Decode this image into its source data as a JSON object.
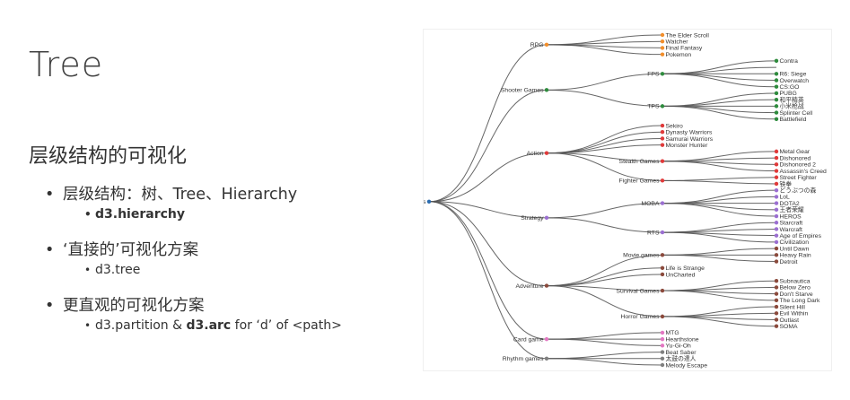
{
  "slide": {
    "title": "Tree",
    "subtitle": "层级结构的可视化",
    "bullets": [
      {
        "text": "层级结构：树、Tree、Hierarchy",
        "sub_bold": "d3.hierarchy"
      },
      {
        "text": "‘直接的’可视化方案",
        "sub": "d3.tree"
      },
      {
        "text": "更直观的可视化方案",
        "sub_parts": [
          "d3.partition & ",
          "d3.arc",
          " for ‘d’ of <path>"
        ]
      }
    ]
  },
  "tree": {
    "name": "Games",
    "color": "#2b6cb0",
    "children": [
      {
        "name": "RPG",
        "color": "#f28e2b",
        "children": [
          {
            "name": "The Elder Scroll"
          },
          {
            "name": "Watcher"
          },
          {
            "name": "Final Fantasy"
          },
          {
            "name": "Pokemon"
          }
        ]
      },
      {
        "name": "Shooter Games",
        "color": "#2e8b3d",
        "children": [
          {
            "name": "FPS",
            "children": [
              {
                "name": "Contra"
              },
              {
                "name": "~",
                "hidden": true
              },
              {
                "name": "R6: Siege"
              },
              {
                "name": "Overwatch"
              },
              {
                "name": "CS:GO"
              }
            ]
          },
          {
            "name": "TPS",
            "children": [
              {
                "name": "PUBG"
              },
              {
                "name": "和平精英"
              },
              {
                "name": "小米枪战"
              },
              {
                "name": "Splinter Cell"
              },
              {
                "name": "Battlefield"
              }
            ]
          }
        ]
      },
      {
        "name": "Action",
        "color": "#e03a3a",
        "children": [
          {
            "name": "Sekiro"
          },
          {
            "name": "Dynasty Warriors"
          },
          {
            "name": "Samurai Warriors"
          },
          {
            "name": "Monster Hunter"
          },
          {
            "name": "Stealth Games",
            "children": [
              {
                "name": "Metal Gear"
              },
              {
                "name": "Dishonored"
              },
              {
                "name": "Dishonored 2"
              },
              {
                "name": "Assassin's Creed"
              }
            ]
          },
          {
            "name": "Fighter Games",
            "children": [
              {
                "name": "Street Fighter"
              },
              {
                "name": "铁拳"
              }
            ]
          }
        ]
      },
      {
        "name": "Strategy",
        "color": "#9b6fd1",
        "children": [
          {
            "name": "MOBA",
            "children": [
              {
                "name": "どうぶつの森"
              },
              {
                "name": "LoL"
              },
              {
                "name": "DOTA2"
              },
              {
                "name": "王者荣耀"
              },
              {
                "name": "HEROS"
              }
            ]
          },
          {
            "name": "RTS",
            "children": [
              {
                "name": "Starcraft"
              },
              {
                "name": "Warcraft"
              },
              {
                "name": "Age of Empires"
              },
              {
                "name": "Civilization"
              }
            ]
          }
        ]
      },
      {
        "name": "Adventure",
        "color": "#8b4a3c",
        "children": [
          {
            "name": "Movie games",
            "children": [
              {
                "name": "Until Dawn"
              },
              {
                "name": "Heavy Rain"
              },
              {
                "name": "Detroit"
              }
            ]
          },
          {
            "name": "Life is Strange"
          },
          {
            "name": "UnCharted"
          },
          {
            "name": "Survival Games",
            "children": [
              {
                "name": "Subnautica"
              },
              {
                "name": "Below Zero"
              },
              {
                "name": "Don't Starve"
              },
              {
                "name": "The Long Dark"
              }
            ]
          },
          {
            "name": "Horror Games",
            "children": [
              {
                "name": "Silent Hill"
              },
              {
                "name": "Evil Within"
              },
              {
                "name": "Outlast"
              },
              {
                "name": "SOMA"
              }
            ]
          }
        ]
      },
      {
        "name": "Card game",
        "color": "#e377c2",
        "children": [
          {
            "name": "MTG"
          },
          {
            "name": "Hearthstone"
          },
          {
            "name": "Yu-Gi-Oh"
          }
        ]
      },
      {
        "name": "Rhythm games",
        "color": "#7f7f7f",
        "children": [
          {
            "name": "Beat Saber"
          },
          {
            "name": "太鼓の達人"
          },
          {
            "name": "Melody Escape"
          }
        ]
      }
    ]
  }
}
